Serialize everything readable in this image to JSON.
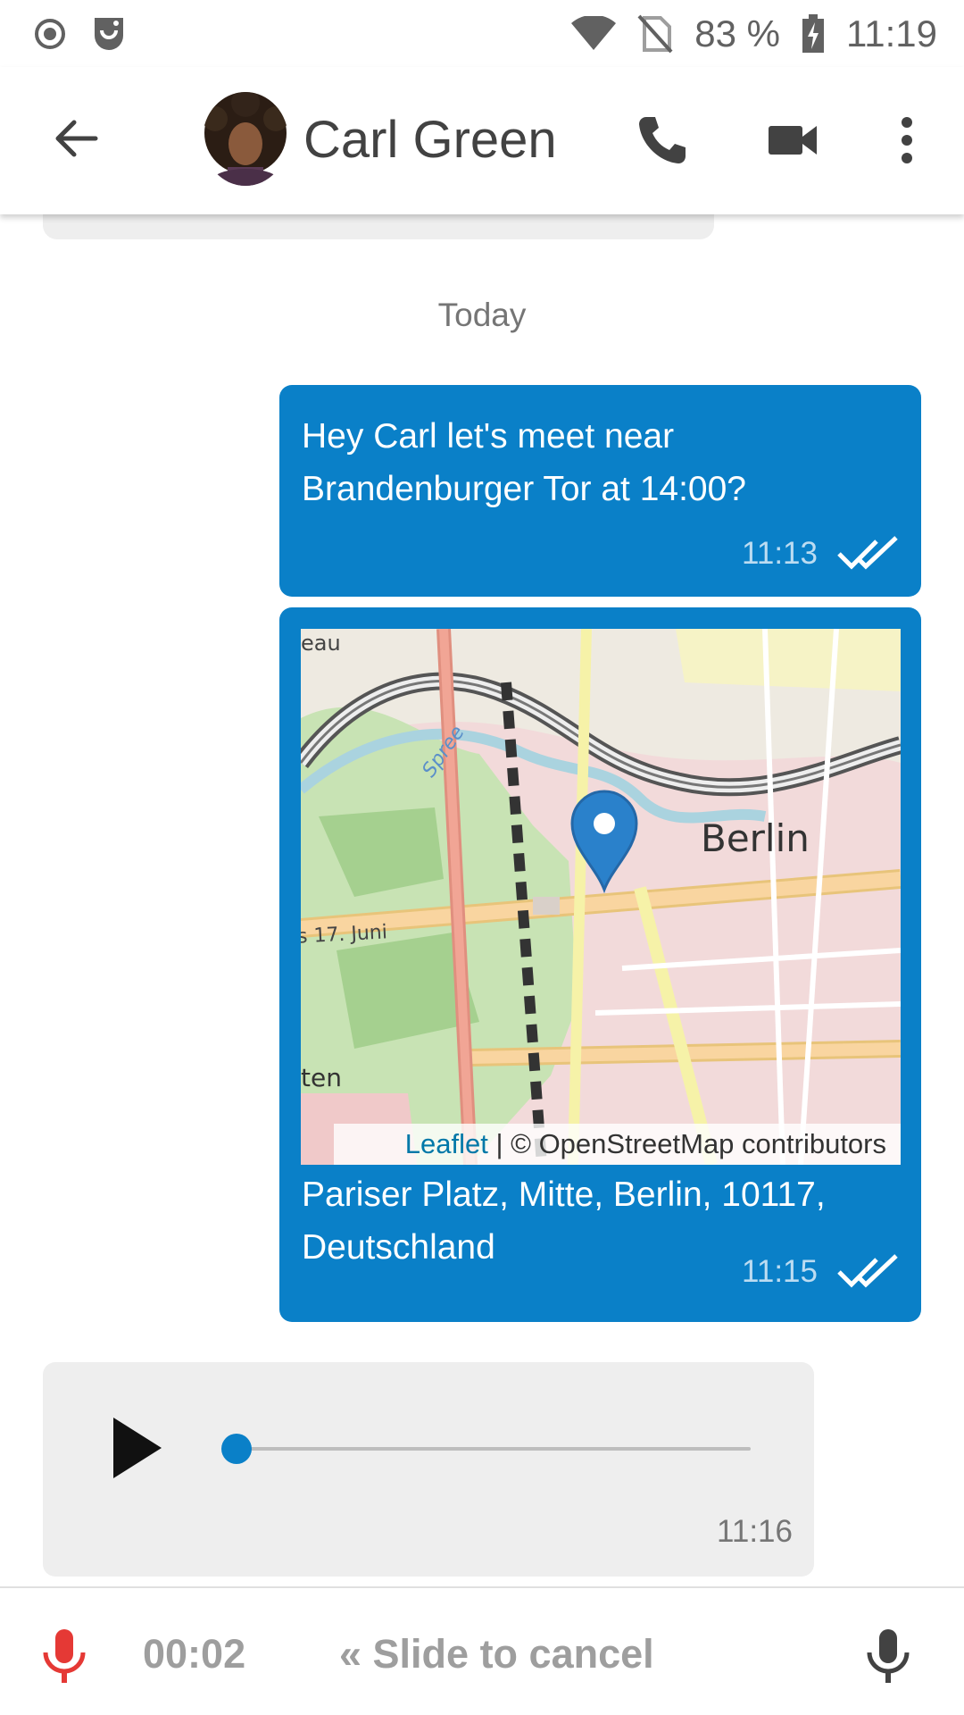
{
  "status_bar": {
    "battery": "83 %",
    "time": "11:19"
  },
  "toolbar": {
    "title": "Carl Green"
  },
  "chat": {
    "date_separator": "Today",
    "messages": [
      {
        "direction": "outgoing",
        "text": "Hey Carl let's meet near Brandenburger Tor at 14:00?",
        "time": "11:13",
        "status": "read"
      },
      {
        "direction": "outgoing",
        "type": "location",
        "map": {
          "city_label": "Berlin",
          "street_label": "s 17. Juni",
          "river_label": "Spree",
          "fragment_top": "eau",
          "fragment_bottom": "ten",
          "attribution_link": "Leaflet",
          "attribution_text": "| © OpenStreetMap contributors"
        },
        "text": "Pariser Platz, Mitte, Berlin, 10117, Deutschland",
        "time": "11:15",
        "status": "read"
      },
      {
        "direction": "incoming",
        "type": "voice",
        "progress": 0,
        "time": "11:16"
      }
    ]
  },
  "recording_bar": {
    "elapsed": "00:02",
    "slide_hint": "« Slide to cancel"
  },
  "colors": {
    "outgoing_bubble": "#0a80c8",
    "incoming_bubble": "#eeeeee",
    "record_mic": "#e53935"
  }
}
